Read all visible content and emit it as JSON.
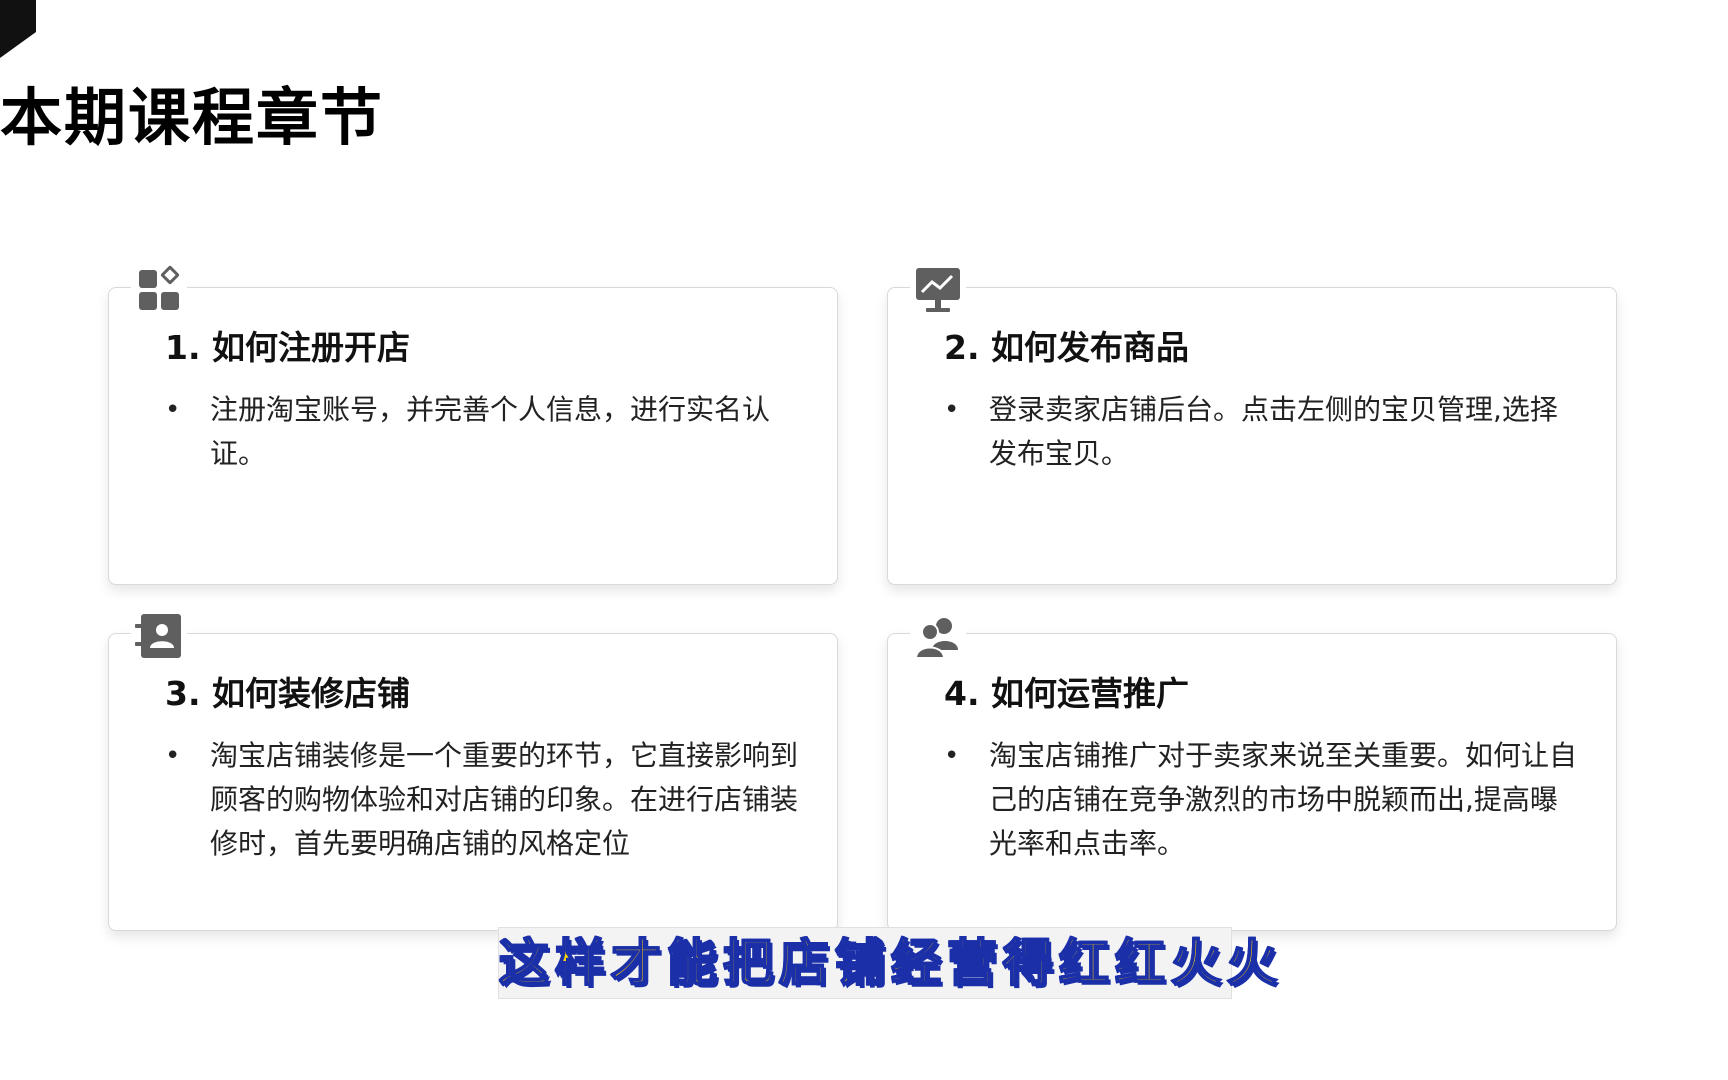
{
  "page": {
    "title": "本期课程章节"
  },
  "cards": [
    {
      "title": "1. 如何注册开店",
      "bullet_marker": "•",
      "bullet": "注册淘宝账号，并完善个人信息，进行实名认证。",
      "icon": "apps-grid-icon"
    },
    {
      "title": "2. 如何发布商品",
      "bullet_marker": "•",
      "bullet": "登录卖家店铺后台。点击左侧的宝贝管理,选择发布宝贝。",
      "icon": "monitor-chart-icon"
    },
    {
      "title": "3. 如何装修店铺",
      "bullet_marker": "•",
      "bullet": "淘宝店铺装修是一个重要的环节，它直接影响到顾客的购物体验和对店铺的印象。在进行店铺装修时，首先要明确店铺的风格定位",
      "icon": "contact-card-icon"
    },
    {
      "title": "4. 如何运营推广",
      "bullet_marker": "•",
      "bullet": "淘宝店铺推广对于卖家来说至关重要。如何让自己的店铺在竞争激烈的市场中脱颖而出,提高曝光率和点击率。",
      "icon": "users-group-icon"
    }
  ],
  "subtitle": {
    "text": "这样才能把店铺经营得红红火火"
  },
  "colors": {
    "icon_gray": "#5f5f5f",
    "subtitle_fill": "#ffd400",
    "subtitle_outline": "#1a2fa8",
    "card_border": "#d9d9d9"
  }
}
